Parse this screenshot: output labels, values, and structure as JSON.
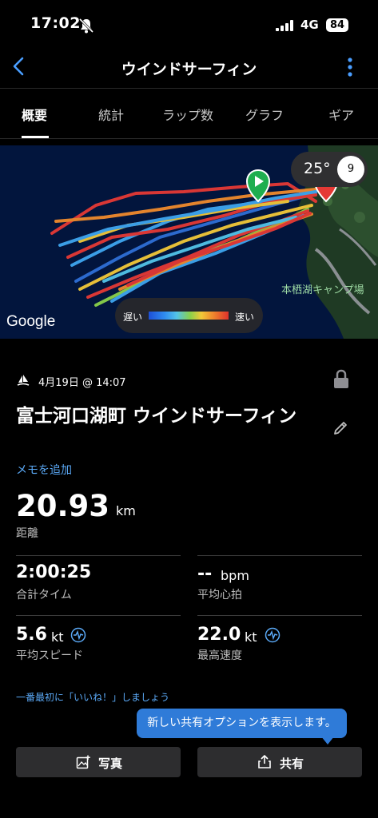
{
  "status_bar": {
    "time": "17:02",
    "network": "4G",
    "battery": "84"
  },
  "header": {
    "title": "ウインドサーフィン"
  },
  "tabs": [
    {
      "label": "概要"
    },
    {
      "label": "統計"
    },
    {
      "label": "ラップ数"
    },
    {
      "label": "グラフ"
    },
    {
      "label": "ギア"
    }
  ],
  "map": {
    "temperature": "25°",
    "wind": "9",
    "place_label": "本栖湖キャンプ場",
    "google_logo": "Google",
    "legend": {
      "slow": "遅い",
      "fast": "速い"
    },
    "colors": {
      "start": "#1fae4f",
      "end": "#e53935",
      "water": "#02153d"
    }
  },
  "activity": {
    "date": "4月19日 @ 14:07",
    "name": "富士河口湖町 ウインドサーフィン",
    "add_memo": "メモを追加",
    "distance": {
      "value": "20.93",
      "unit": "km",
      "label": "距離"
    }
  },
  "stats": [
    {
      "value": "2:00:25",
      "unit": "",
      "label": "合計タイム"
    },
    {
      "value": "--",
      "unit": "bpm",
      "label": "平均心拍"
    },
    {
      "value": "5.6",
      "unit": "kt",
      "label": "平均スピード"
    },
    {
      "value": "22.0",
      "unit": "kt",
      "label": "最高速度"
    }
  ],
  "like_prompt": "一番最初に「いいね！」しましょう",
  "tooltip": "新しい共有オプションを表示します。",
  "buttons": {
    "photo": "写真",
    "share": "共有"
  },
  "accent": "#5aa8f5"
}
